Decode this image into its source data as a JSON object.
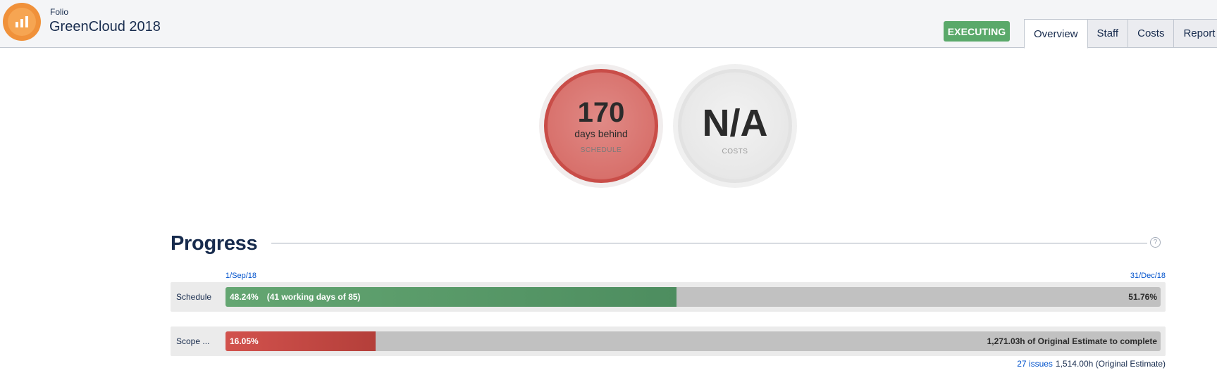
{
  "header": {
    "app_name": "Folio",
    "project_title": "GreenCloud 2018",
    "status": "EXECUTING",
    "status_color": "#5aa96a",
    "logo_icon": "bar-chart-icon",
    "tabs": [
      {
        "label": "Overview",
        "active": true
      },
      {
        "label": "Staff",
        "active": false
      },
      {
        "label": "Costs",
        "active": false
      },
      {
        "label": "Report",
        "active": false
      }
    ]
  },
  "gauges": {
    "schedule": {
      "value": "170",
      "caption": "days behind",
      "label": "SCHEDULE",
      "color": "#d8716c"
    },
    "costs": {
      "value": "N/A",
      "label": "COSTS",
      "color": "#e6e6e6"
    }
  },
  "progress": {
    "title": "Progress",
    "help_icon": "question-circle-icon",
    "start_date": "1/Sep/18",
    "end_date": "31/Dec/18",
    "schedule": {
      "label": "Schedule",
      "percent_done": "48.24%",
      "fraction_done": 0.4824,
      "detail": "(41 working days of 85)",
      "percent_remaining": "51.76%",
      "color": "#5aa96a"
    },
    "scope": {
      "label": "Scope ...",
      "percent_done": "16.05%",
      "fraction_done": 0.1605,
      "remaining_text": "1,271.03h of Original Estimate to complete",
      "color": "#c94d48",
      "issues_link": "27 issues",
      "total_estimate": "1,514.00h (Original Estimate)"
    }
  }
}
